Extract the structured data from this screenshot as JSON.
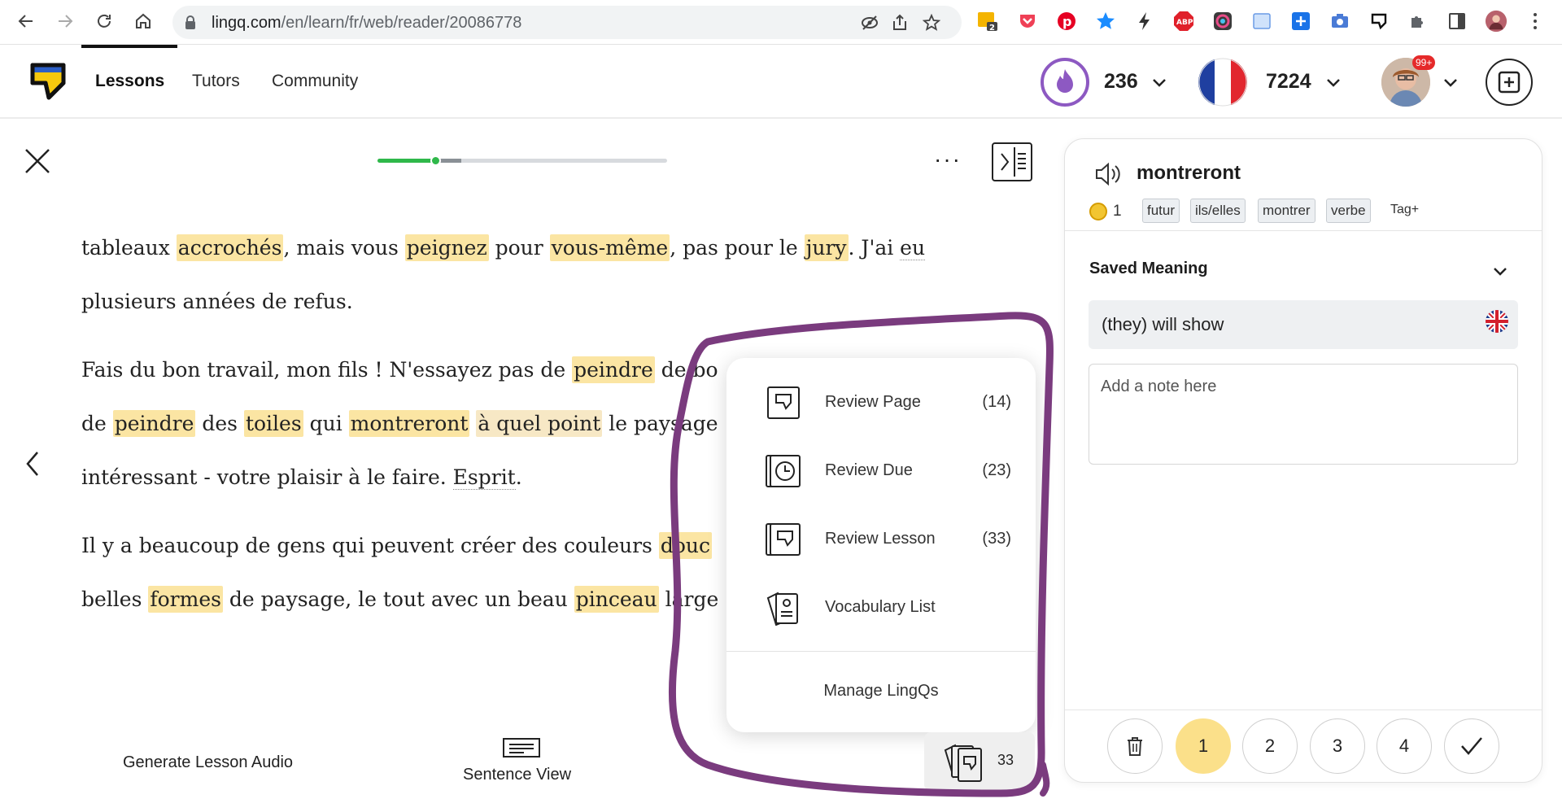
{
  "browser": {
    "url_host": "lingq.com",
    "url_path": "/en/learn/fr/web/reader/20086778",
    "extension_badge": "2"
  },
  "header": {
    "nav": [
      "Lessons",
      "Tutors",
      "Community"
    ],
    "streak": "236",
    "known_words": "7224",
    "avatar_badge": "99+"
  },
  "reader": {
    "progress_fraction": 0.2,
    "lines": [
      [
        {
          "t": "tableaux ",
          "k": ""
        },
        {
          "t": "accrochés",
          "k": "lq"
        },
        {
          "t": ", mais vous ",
          "k": ""
        },
        {
          "t": "peignez",
          "k": "lq"
        },
        {
          "t": " pour ",
          "k": ""
        },
        {
          "t": "vous-même",
          "k": "lq"
        },
        {
          "t": ", pas pour le ",
          "k": ""
        },
        {
          "t": "jury",
          "k": "lq"
        },
        {
          "t": ".  J'ai ",
          "k": ""
        },
        {
          "t": "eu",
          "k": "dot"
        }
      ],
      [
        {
          "t": "plusieurs années de refus.",
          "k": ""
        }
      ],
      [
        {
          "t": "Fais du bon travail, mon fils !  N'essayez pas de ",
          "k": ""
        },
        {
          "t": "peindre",
          "k": "lq"
        },
        {
          "t": " de bo",
          "k": ""
        }
      ],
      [
        {
          "t": "de ",
          "k": ""
        },
        {
          "t": "peindre",
          "k": "lq"
        },
        {
          "t": " des ",
          "k": ""
        },
        {
          "t": "toiles",
          "k": "lq"
        },
        {
          "t": " qui ",
          "k": ""
        },
        {
          "t": "montreront",
          "k": "lq"
        },
        {
          "t": " ",
          "k": ""
        },
        {
          "t": "à quel point",
          "k": "lq"
        },
        {
          "t": " le paysage",
          "k": ""
        }
      ],
      [
        {
          "t": "intéressant - votre plaisir à le faire.  ",
          "k": ""
        },
        {
          "t": "Esprit",
          "k": "dot"
        },
        {
          "t": ".",
          "k": ""
        }
      ],
      [
        {
          "t": "Il y a beaucoup de gens qui peuvent créer des couleurs ",
          "k": ""
        },
        {
          "t": "douc",
          "k": "lq"
        }
      ],
      [
        {
          "t": "belles ",
          "k": ""
        },
        {
          "t": "formes",
          "k": "lq"
        },
        {
          "t": " de paysage, le tout avec un beau ",
          "k": ""
        },
        {
          "t": "pinceau",
          "k": "lq"
        },
        {
          "t": " large",
          "k": ""
        }
      ]
    ],
    "footer": {
      "generate_audio": "Generate Lesson Audio",
      "sentence_view": "Sentence View",
      "lingq_count": "33"
    }
  },
  "review_menu": {
    "items": [
      {
        "label": "Review Page",
        "count": "(14)",
        "icon": "review-page-icon"
      },
      {
        "label": "Review Due",
        "count": "(23)",
        "icon": "clock-card-icon"
      },
      {
        "label": "Review Lesson",
        "count": "(33)",
        "icon": "review-lesson-icon"
      },
      {
        "label": "Vocabulary List",
        "count": "",
        "icon": "vocabulary-list-icon"
      }
    ],
    "manage": "Manage LingQs"
  },
  "panel": {
    "term": "montreront",
    "coin_count": "1",
    "tags": [
      "futur",
      "ils/elles",
      "montrer",
      "verbe"
    ],
    "tag_add": "Tag+",
    "saved_meaning_title": "Saved Meaning",
    "meaning": "(they) will show",
    "note_placeholder": "Add a note here",
    "status_levels": [
      "1",
      "2",
      "3",
      "4"
    ],
    "selected_status": "1"
  },
  "colors": {
    "lingq_highlight": "#fbe5a3",
    "status_selected": "#fbe08a",
    "annotation": "#7a3b7e",
    "progress": "#2fb84a"
  }
}
